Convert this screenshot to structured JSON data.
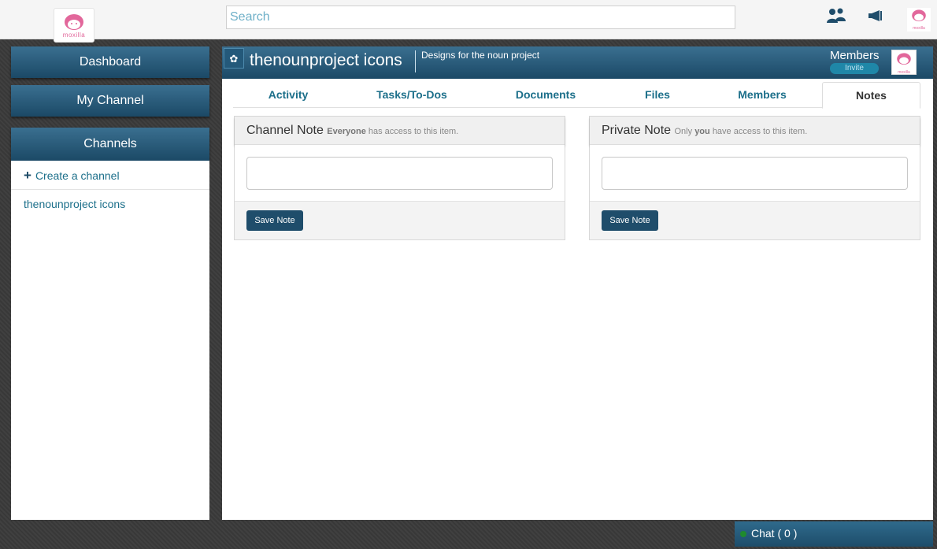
{
  "brand": {
    "logo_text": "moxilla"
  },
  "search": {
    "placeholder": "Search"
  },
  "sidebar": {
    "dashboard": "Dashboard",
    "my_channel": "My Channel",
    "channels": "Channels",
    "create_channel": "Create a channel",
    "channel_items": [
      "thenounproject icons"
    ]
  },
  "channel": {
    "title": "thenounproject icons",
    "description": "Designs for the noun project",
    "members_label": "Members",
    "invite_label": "Invite"
  },
  "tabs": [
    "Activity",
    "Tasks/To-Dos",
    "Documents",
    "Files",
    "Members",
    "Notes"
  ],
  "active_tab": "Notes",
  "notes": {
    "channel": {
      "title": "Channel Note",
      "scope_bold": "Everyone",
      "scope_text": "has access to this item.",
      "save_label": "Save Note"
    },
    "private": {
      "title": "Private Note",
      "scope_prefix": "Only",
      "scope_bold": "you",
      "scope_text": "have access to this item.",
      "save_label": "Save Note"
    }
  },
  "chat": {
    "label": "Chat ( 0 )"
  },
  "colors": {
    "accent": "#1b4966",
    "link": "#1c6f8a",
    "brand_pink": "#e2679b",
    "online": "#1f8a2e"
  }
}
